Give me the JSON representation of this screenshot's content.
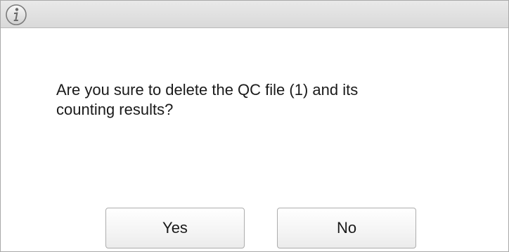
{
  "dialog": {
    "icon": "info-icon",
    "message": "Are you sure to delete the QC file (1) and its\ncounting results?",
    "buttons": {
      "yes_label": "Yes",
      "no_label": "No"
    }
  }
}
